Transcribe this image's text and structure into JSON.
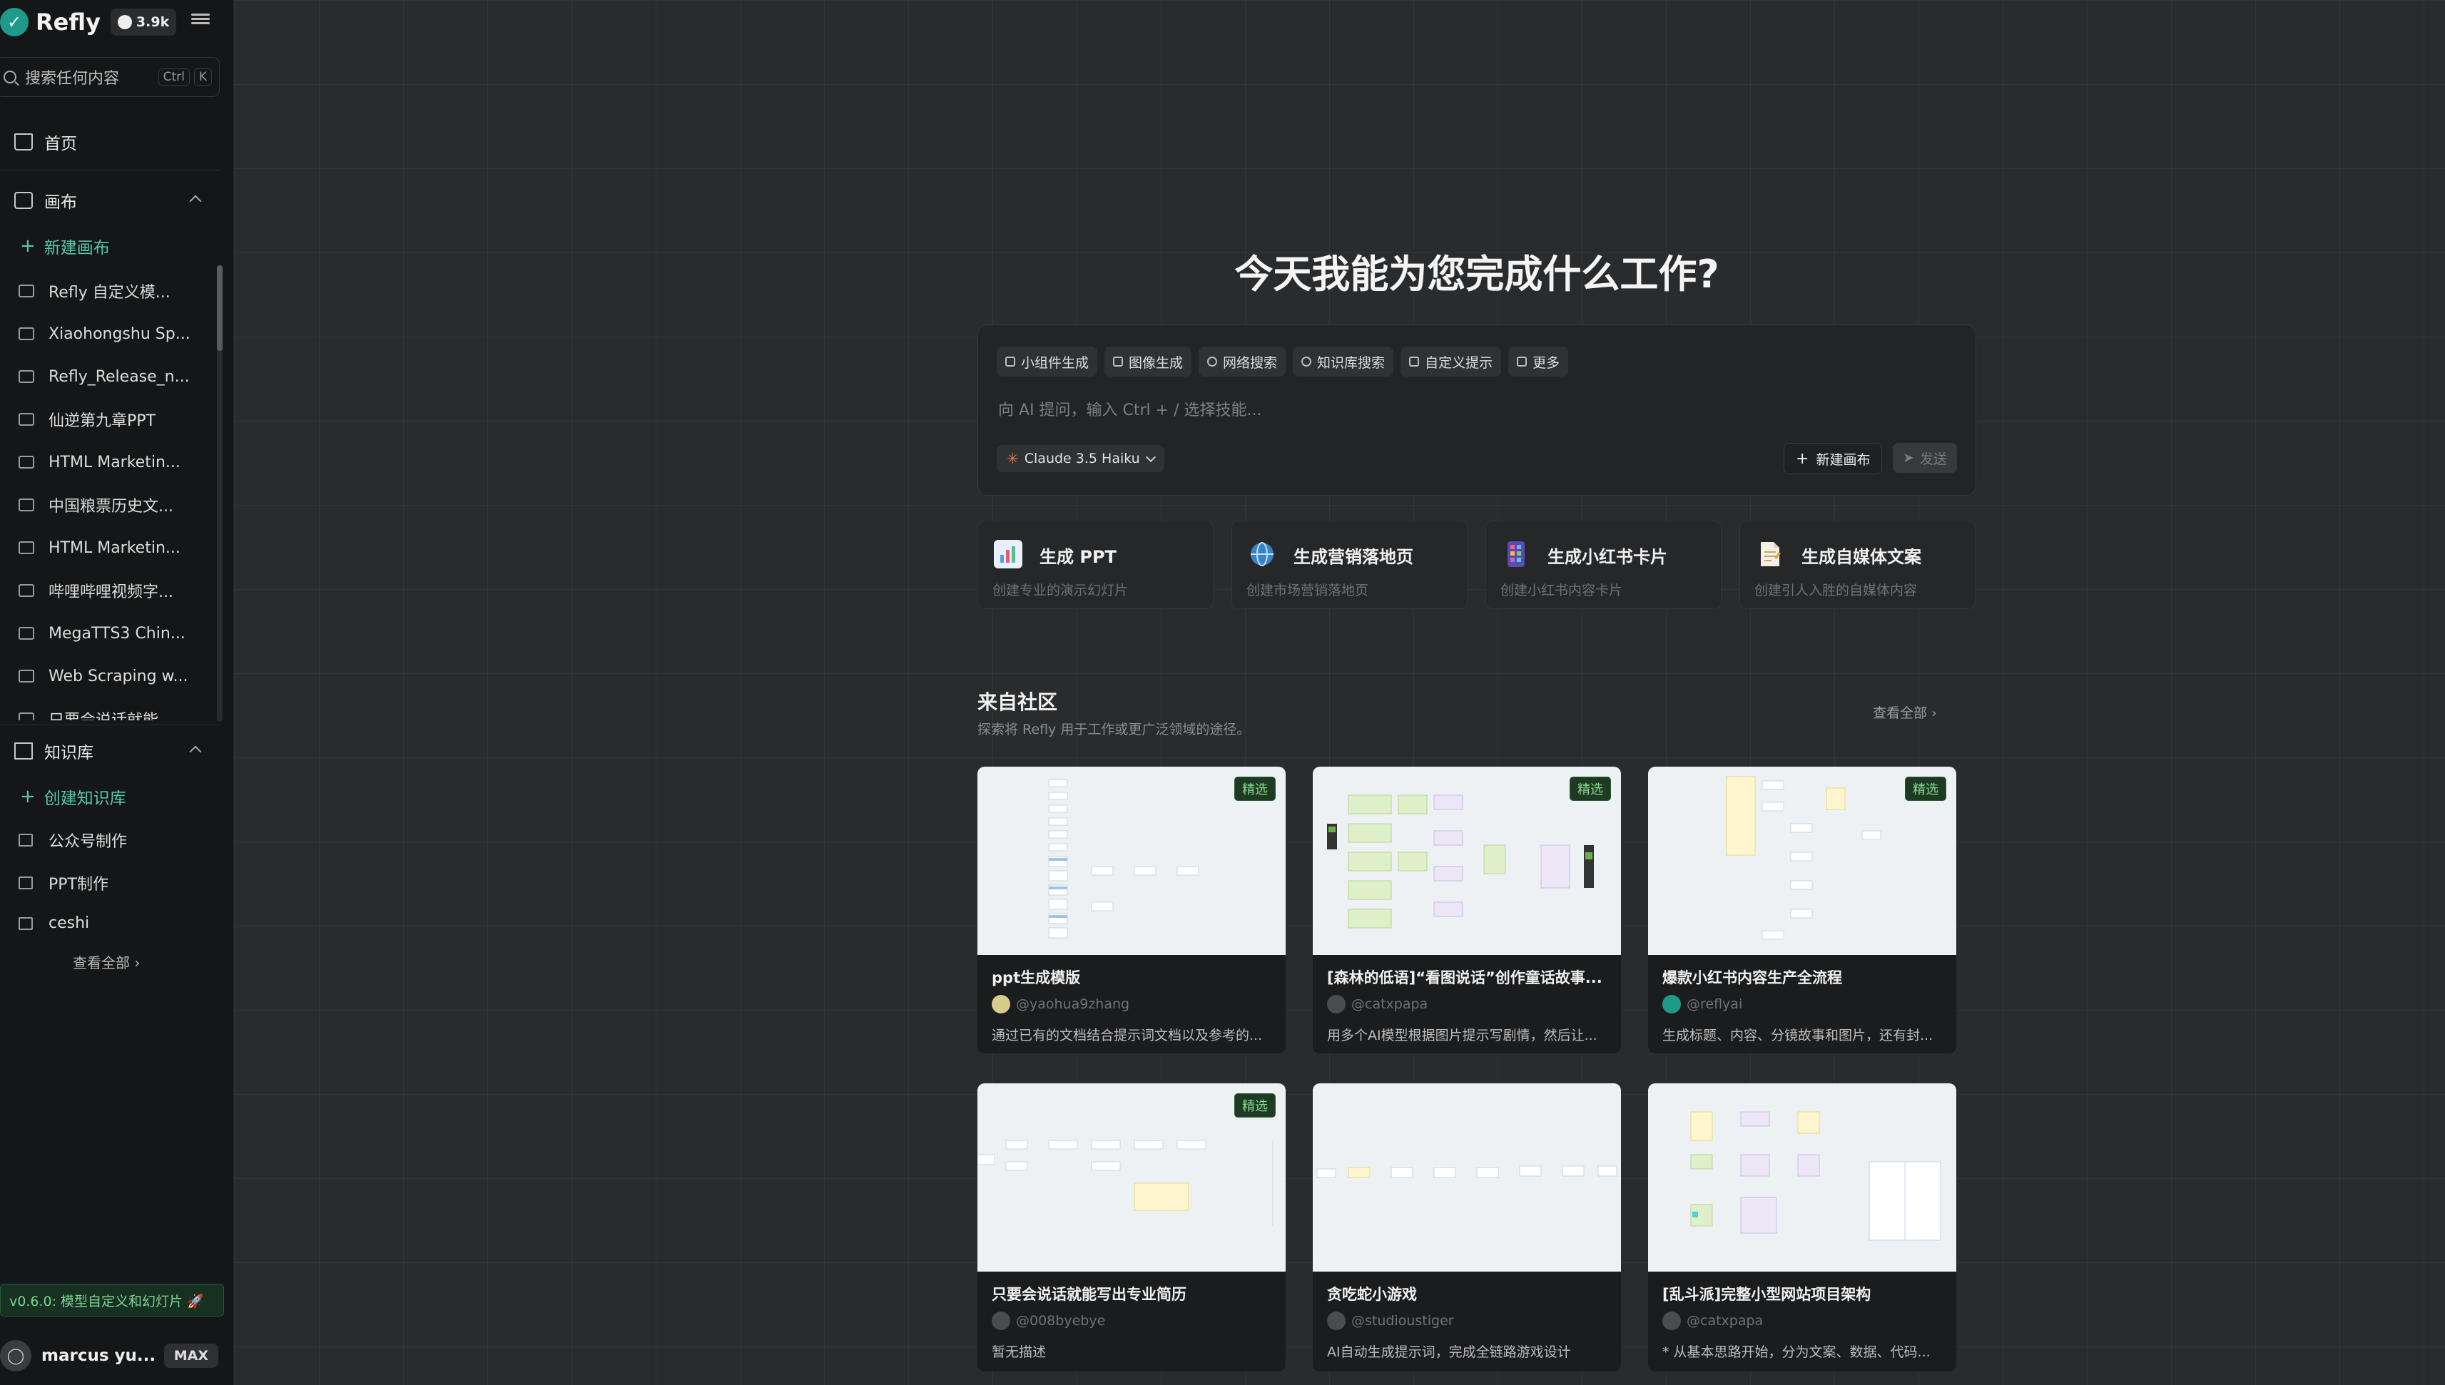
{
  "app": {
    "brand": "Refly",
    "github_stars": "3.9k"
  },
  "sidebar": {
    "search": {
      "placeholder": "搜索任何内容",
      "kbd_ctrl": "Ctrl",
      "kbd_k": "K"
    },
    "home_label": "首页",
    "canvas_section": {
      "label": "画布",
      "create_label": "新建画布",
      "items": [
        "Refly 自定义模...",
        "Xiaohongshu Sp...",
        "Refly_Release_n...",
        "仙逆第九章PPT",
        "HTML Marketin...",
        "中国粮票历史文...",
        "HTML Marketin...",
        "哔哩哔哩视频字...",
        "MegaTTS3 Chin...",
        "Web Scraping w...",
        "只要会说话就能..."
      ]
    },
    "knowledge_section": {
      "label": "知识库",
      "create_label": "创建知识库",
      "items": [
        "公众号制作",
        "PPT制作",
        "ceshi"
      ],
      "see_all": "查看全部"
    },
    "version_text": "v0.6.0: 模型自定义和幻灯片 🚀",
    "user": {
      "name": "marcus yu...",
      "plan": "MAX"
    }
  },
  "main": {
    "hero_title": "今天我能为您完成什么工作?",
    "prompt": {
      "chips": [
        "小组件生成",
        "图像生成",
        "网络搜索",
        "知识库搜索",
        "自定义提示",
        "更多"
      ],
      "placeholder": "向 AI 提问，输入 Ctrl + / 选择技能...",
      "model": "Claude 3.5 Haiku",
      "new_canvas_label": "新建画布",
      "send_label": "发送"
    },
    "quick_actions": [
      {
        "title": "生成 PPT",
        "desc": "创建专业的演示幻灯片",
        "icon": "chart-icon",
        "color": "#4fa3e0"
      },
      {
        "title": "生成营销落地页",
        "desc": "创建市场营销落地页",
        "icon": "globe-icon",
        "color": "#3b82c4"
      },
      {
        "title": "生成小红书卡片",
        "desc": "创建小红书内容卡片",
        "icon": "phone-icon",
        "color": "#8e5ad8"
      },
      {
        "title": "生成自媒体文案",
        "desc": "创建引人入胜的自媒体内容",
        "icon": "document-icon",
        "color": "#e8a24a"
      }
    ],
    "community": {
      "title": "来自社区",
      "subtitle": "探索将 Refly 用于工作或更广泛领域的途径。",
      "see_all": "查看全部",
      "featured_label": "精选",
      "cards": [
        {
          "title": "ppt生成模版",
          "author": "@yaohua9zhang",
          "desc": "通过已有的文档结合提示词文档以及参考的...",
          "featured": true
        },
        {
          "title": "[森林的低语]“看图说话”创作童话故事...",
          "author": "@catxpapa",
          "desc": "用多个AI模型根据图片提示写剧情，然后让...",
          "featured": true
        },
        {
          "title": "爆款小红书内容生产全流程",
          "author": "@reflyai",
          "desc": "生成标题、内容、分镜故事和图片，还有封...",
          "featured": true
        },
        {
          "title": "只要会说话就能写出专业简历",
          "author": "@008byebye",
          "desc": "暂无描述",
          "featured": true
        },
        {
          "title": "贪吃蛇小游戏",
          "author": "@studioustiger",
          "desc": "AI自动生成提示词，完成全链路游戏设计",
          "featured": false
        },
        {
          "title": "[乱斗派]完整小型网站项目架构",
          "author": "@catxpapa",
          "desc": "* 从基本思路开始，分为文案、数据、代码...",
          "featured": false
        }
      ]
    }
  }
}
